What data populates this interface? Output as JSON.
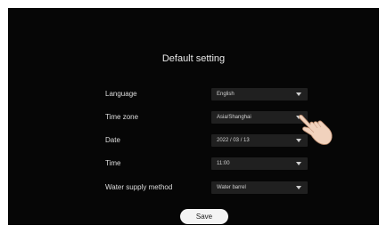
{
  "screen": {
    "title": "Default setting",
    "settings": [
      {
        "label": "Language",
        "value": "English"
      },
      {
        "label": "Time zone",
        "value": "Asia/Shanghai"
      },
      {
        "label": "Date",
        "value": "2022 / 03 / 13"
      },
      {
        "label": "Time",
        "value": "11:00"
      },
      {
        "label": "Water supply method",
        "value": "Water barrel"
      }
    ],
    "save_label": "Save",
    "pointer_icon": "pointing-hand-icon"
  }
}
